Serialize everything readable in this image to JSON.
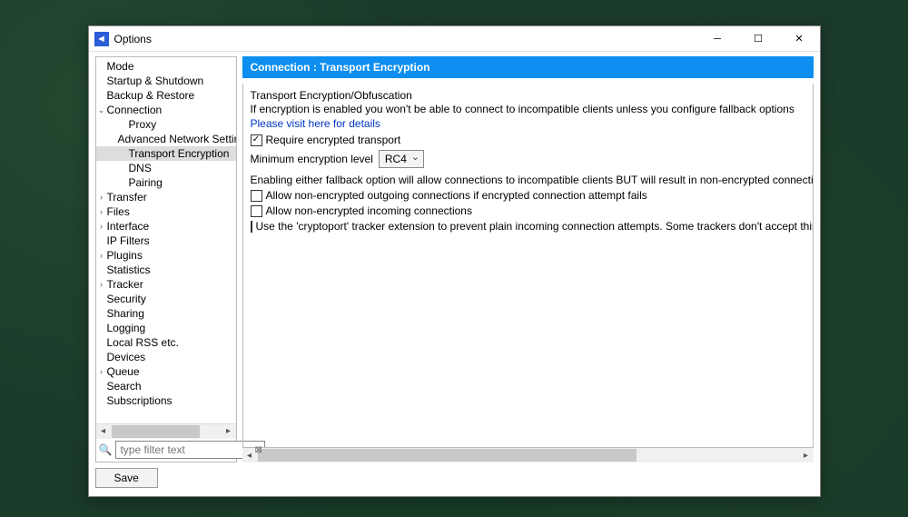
{
  "window": {
    "title": "Options"
  },
  "sidebar": {
    "items": [
      {
        "label": "Mode",
        "level": 0,
        "expander": ""
      },
      {
        "label": "Startup & Shutdown",
        "level": 0,
        "expander": ""
      },
      {
        "label": "Backup & Restore",
        "level": 0,
        "expander": ""
      },
      {
        "label": "Connection",
        "level": 0,
        "expander": "⌄",
        "expanded": true
      },
      {
        "label": "Proxy",
        "level": 1,
        "expander": ""
      },
      {
        "label": "Advanced Network Settin",
        "level": 1,
        "expander": ""
      },
      {
        "label": "Transport Encryption",
        "level": 1,
        "expander": "",
        "selected": true
      },
      {
        "label": "DNS",
        "level": 1,
        "expander": ""
      },
      {
        "label": "Pairing",
        "level": 1,
        "expander": ""
      },
      {
        "label": "Transfer",
        "level": 0,
        "expander": "›"
      },
      {
        "label": "Files",
        "level": 0,
        "expander": "›"
      },
      {
        "label": "Interface",
        "level": 0,
        "expander": "›"
      },
      {
        "label": "IP Filters",
        "level": 0,
        "expander": ""
      },
      {
        "label": "Plugins",
        "level": 0,
        "expander": "›"
      },
      {
        "label": "Statistics",
        "level": 0,
        "expander": ""
      },
      {
        "label": "Tracker",
        "level": 0,
        "expander": "›"
      },
      {
        "label": "Security",
        "level": 0,
        "expander": ""
      },
      {
        "label": "Sharing",
        "level": 0,
        "expander": ""
      },
      {
        "label": "Logging",
        "level": 0,
        "expander": ""
      },
      {
        "label": "Local RSS etc.",
        "level": 0,
        "expander": ""
      },
      {
        "label": "Devices",
        "level": 0,
        "expander": ""
      },
      {
        "label": "Queue",
        "level": 0,
        "expander": "›"
      },
      {
        "label": "Search",
        "level": 0,
        "expander": ""
      },
      {
        "label": "Subscriptions",
        "level": 0,
        "expander": ""
      }
    ],
    "filter_placeholder": "type filter text"
  },
  "content": {
    "header": "Connection : Transport Encryption",
    "section_title": "Transport Encryption/Obfuscation",
    "info_text": "If encryption is enabled you won't be able to connect to incompatible clients unless you configure fallback options",
    "details_link": "Please visit here for details",
    "require_encrypted": {
      "label": "Require encrypted transport",
      "checked": true
    },
    "min_level_label": "Minimum encryption level",
    "min_level_value": "RC4",
    "fallback_info": "Enabling either fallback option will allow connections to incompatible clients BUT will result in non-encrypted connections",
    "allow_outgoing": {
      "label": "Allow non-encrypted outgoing connections if encrypted connection attempt fails",
      "checked": false
    },
    "allow_incoming": {
      "label": "Allow non-encrypted incoming connections",
      "checked": false
    },
    "cryptoport": {
      "label": "Use the 'cryptoport' tracker extension to prevent plain incoming connection attempts. Some trackers don't accept this and fail with er",
      "checked": false
    }
  },
  "buttons": {
    "save": "Save"
  }
}
